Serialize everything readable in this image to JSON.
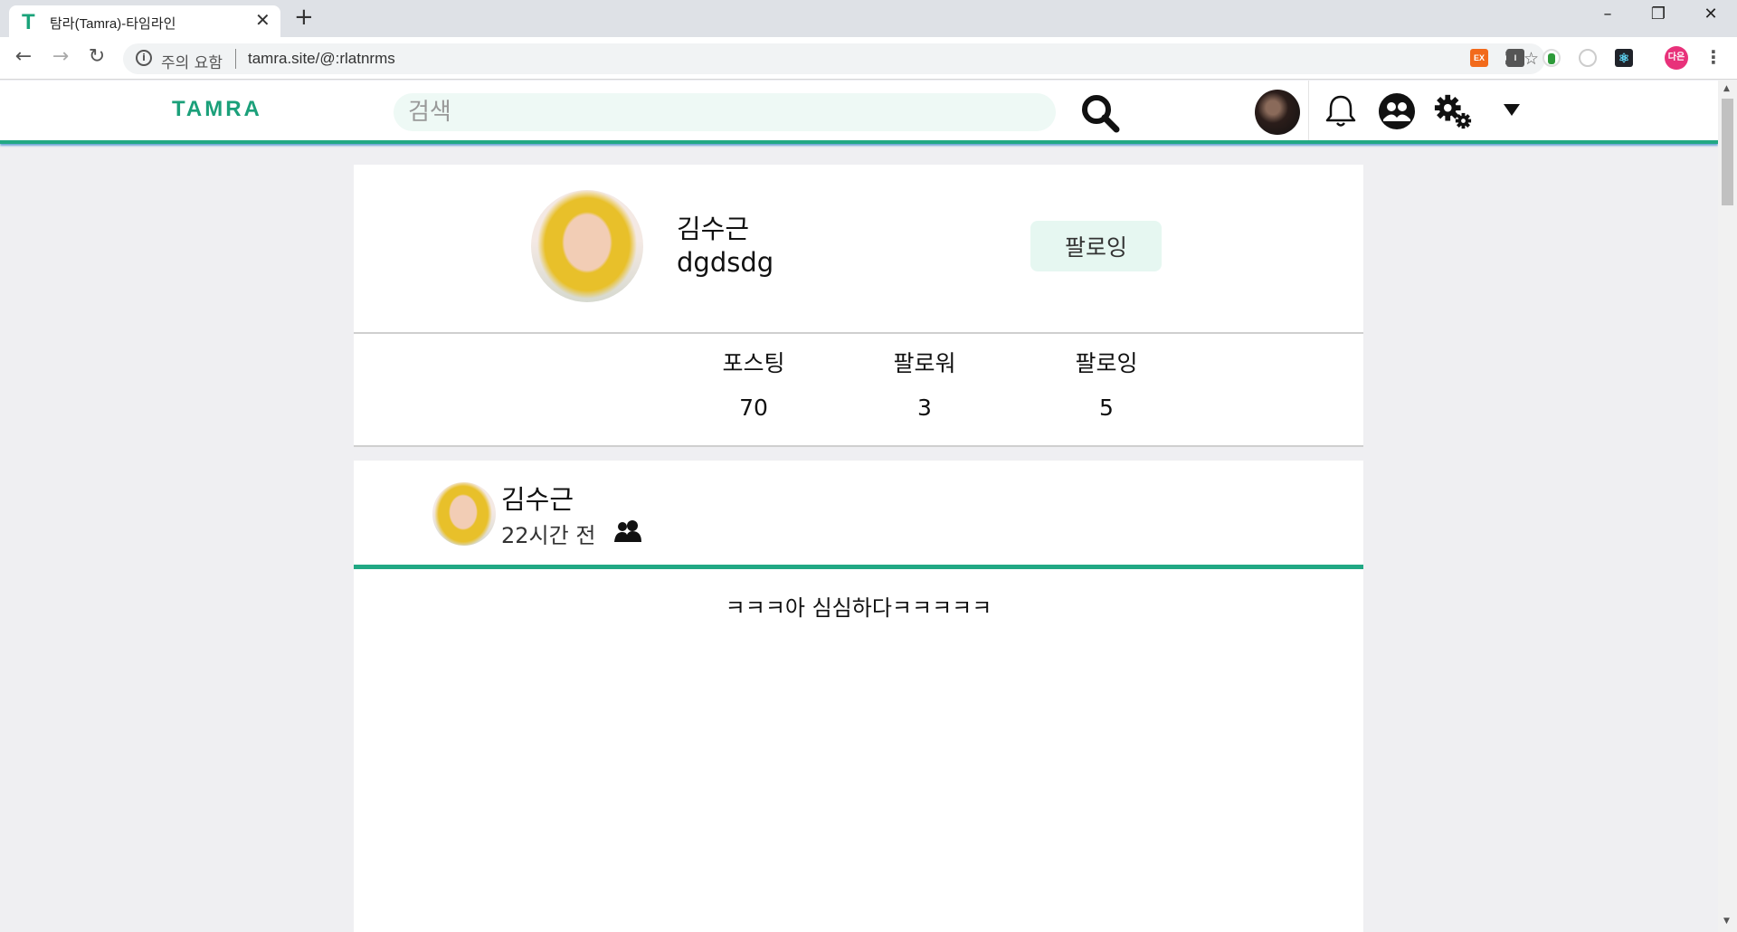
{
  "browser": {
    "tab_title": "탐라(Tamra)-타임라인",
    "favicon_letter": "T",
    "security_warning": "주의 요함",
    "url": "tamra.site/@:rlatnrms",
    "extensions": [
      {
        "name": "ex-extension",
        "label": "EX",
        "color": "#f26a1b"
      },
      {
        "name": "i-extension",
        "label": "I",
        "color": "#555555"
      },
      {
        "name": "green-extension",
        "label": "",
        "color": "#2e9b3a"
      },
      {
        "name": "react-devtools-extension",
        "label": "",
        "color": "#20232a"
      }
    ],
    "profile_badge": "다은"
  },
  "site": {
    "logo": "TAMRA",
    "search_placeholder": "검색",
    "accent_color": "#21a884"
  },
  "profile": {
    "name": "김수근",
    "handle": "dgdsdg",
    "follow_label": "팔로잉",
    "stats": [
      {
        "label": "포스팅",
        "value": "70"
      },
      {
        "label": "팔로워",
        "value": "3"
      },
      {
        "label": "팔로잉",
        "value": "5"
      }
    ]
  },
  "post": {
    "author": "김수근",
    "time": "22시간 전",
    "audience_icon": "friends-icon",
    "text": "ㅋㅋㅋ아 심심하다ㅋㅋㅋㅋㅋ"
  }
}
